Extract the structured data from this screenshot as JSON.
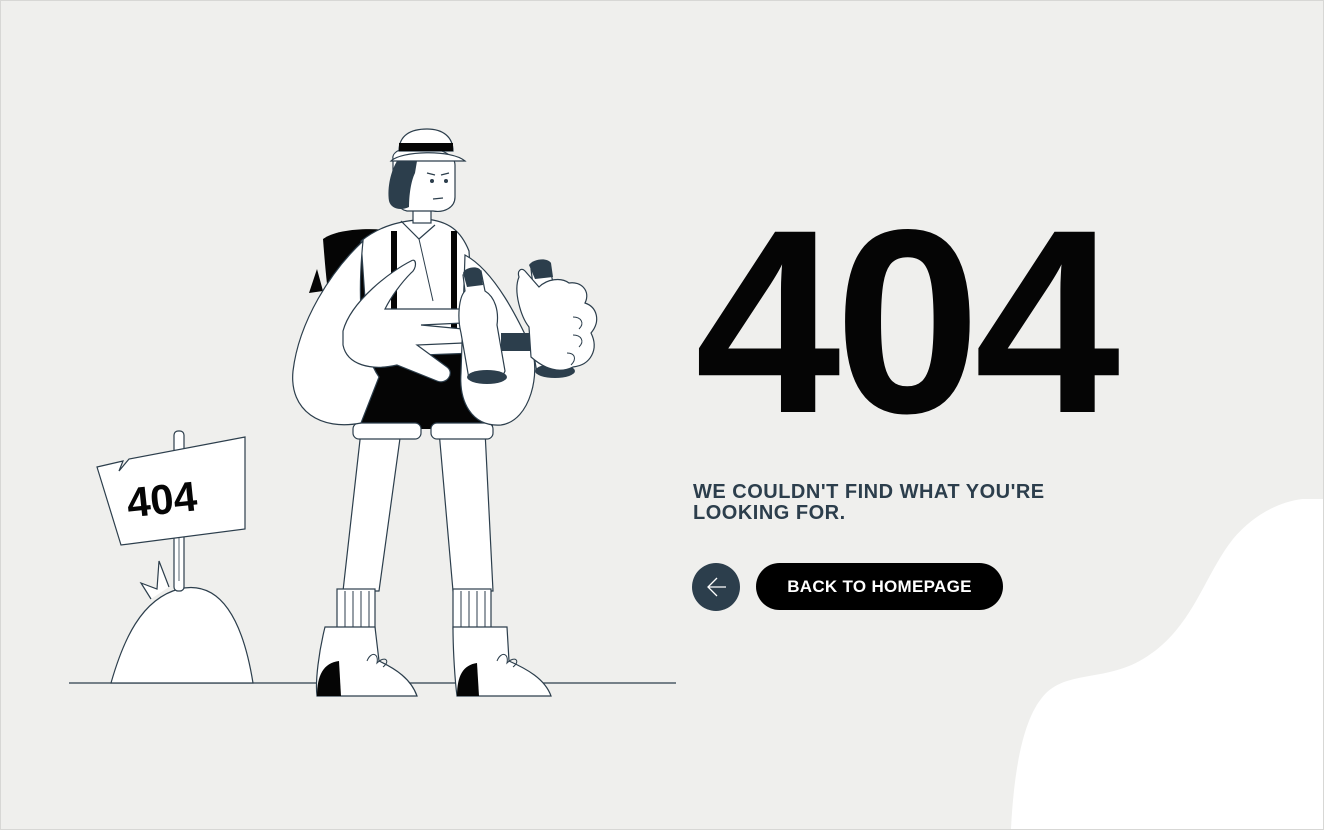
{
  "error": {
    "code": "404",
    "message": "WE COULDN'T FIND WHAT YOU'RE LOOKING FOR.",
    "sign_text": "404"
  },
  "actions": {
    "back_icon": "arrow-left-icon",
    "home_label": "BACK TO HOMEPAGE"
  },
  "colors": {
    "background": "#efefed",
    "accent_dark": "#2c3e4c",
    "text_black": "#050505",
    "button_bg": "#000000",
    "button_text": "#ffffff",
    "blob": "#ffffff"
  }
}
